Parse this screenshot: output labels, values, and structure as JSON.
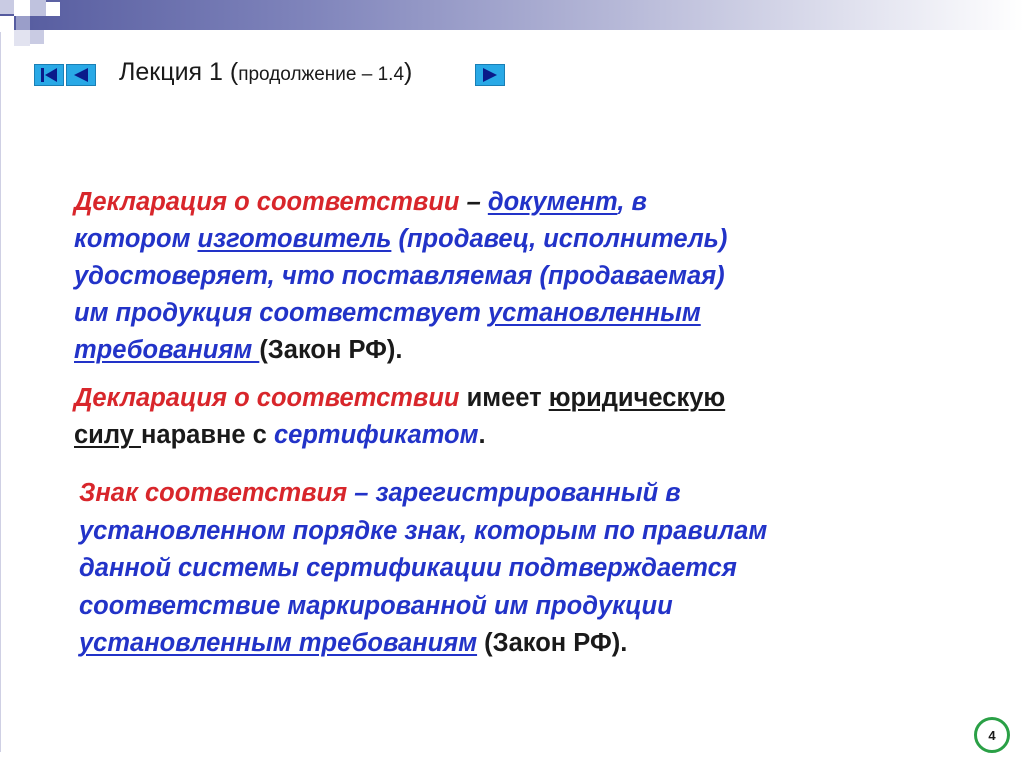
{
  "header": {
    "title_main": "Лекция 1 (",
    "title_small": "продолжение – 1.4",
    "title_end": ")",
    "nav_first_icon": "skip-to-first-icon",
    "nav_prev_icon": "triangle-left-icon",
    "nav_next_icon": "triangle-right-icon"
  },
  "paragraph1": {
    "l1_a": "Декларация о соответствии",
    "l1_b": " – ",
    "l1_c": "документ",
    "l1_d": ", в",
    "l2_a": "котором ",
    "l2_b": "изготовитель",
    "l2_c": " (продавец, исполнитель)",
    "l3": "удостоверяет, что поставляемая (продаваемая)",
    "l4_a": "им продукция соответствует ",
    "l4_b": "установленным",
    "l5_a": "требованиям ",
    "l5_b": "(Закон РФ)."
  },
  "paragraph2": {
    "l1_a": "Декларация о соответствии",
    "l1_b": " имеет ",
    "l1_c": "юридическую",
    "l2_a": "силу ",
    "l2_b": "наравне с ",
    "l2_c": "сертификатом",
    "l2_d": "."
  },
  "paragraph3": {
    "l1_a": "Знак соответствия",
    "l1_b": " – зарегистрированный в",
    "l2": "установленном порядке знак, которым по правилам",
    "l3": "данной системы сертификации подтверждается",
    "l4": "соответствие маркированной им продукции",
    "l5_a": "установленным требованиям",
    "l5_b": " (Закон РФ)."
  },
  "footer": {
    "page_number": "4"
  },
  "colors": {
    "red": "#d8262b",
    "blue": "#2233c8",
    "nav_button": "#29a9e6",
    "page_badge": "#2aa046"
  }
}
